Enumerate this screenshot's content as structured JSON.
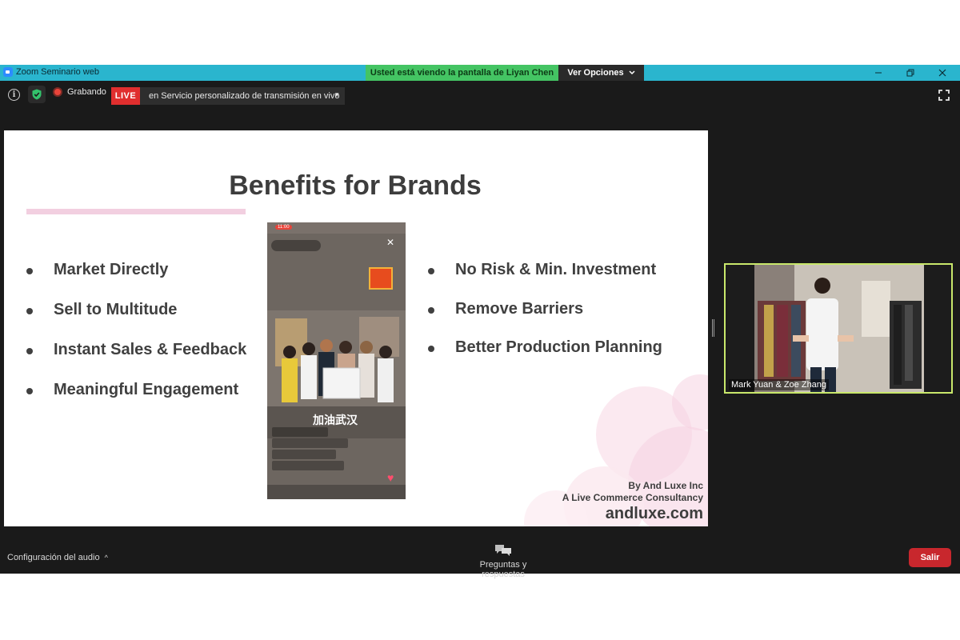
{
  "titlebar": {
    "app_title": "Zoom Seminario web",
    "share_banner": "Usted está viendo la pantalla de Liyan Chen",
    "view_options": "Ver Opciones",
    "icons": [
      "zoom-logo-icon",
      "minimize-icon",
      "restore-icon",
      "close-icon"
    ]
  },
  "toolbar": {
    "recording_label": "Grabando",
    "live_badge": "LIVE",
    "live_service": "en Servicio personalizado de transmisión en vivo",
    "icons": [
      "info-icon",
      "shield-check-icon",
      "record-icon",
      "chevron-down-icon",
      "fullscreen-icon"
    ],
    "colors": {
      "live": "#e02e2e",
      "shield": "#33c26b",
      "banner": "#44c463",
      "titlebar": "#2ab5ce"
    }
  },
  "slide": {
    "title": "Benefits for Brands",
    "left_bullets": [
      "Market Directly",
      "Sell to Multitude",
      "Instant Sales & Feedback",
      "Meaningful Engagement"
    ],
    "right_bullets": [
      "No Risk & Min. Investment",
      "Remove Barriers",
      "Better Production Planning"
    ],
    "credit_line1": "By And Luxe Inc",
    "credit_line2": "A Live Commerce Consultancy",
    "credit_url": "andluxe.com",
    "phone_time": "11:00",
    "phone_caption": "加油武汉",
    "colors": {
      "accent_rule": "#f2cfe0",
      "text": "#3d3d3d"
    }
  },
  "video": {
    "participant_name": "Mark Yuan & Zoe Zhang",
    "border_color": "#c9e86b"
  },
  "bottombar": {
    "audio_config": "Configuración del audio",
    "qa_label": "Preguntas y respuestas",
    "leave": "Salir",
    "icons": [
      "chevron-up-icon",
      "qa-chat-icon"
    ],
    "colors": {
      "leave": "#c8272d"
    }
  }
}
